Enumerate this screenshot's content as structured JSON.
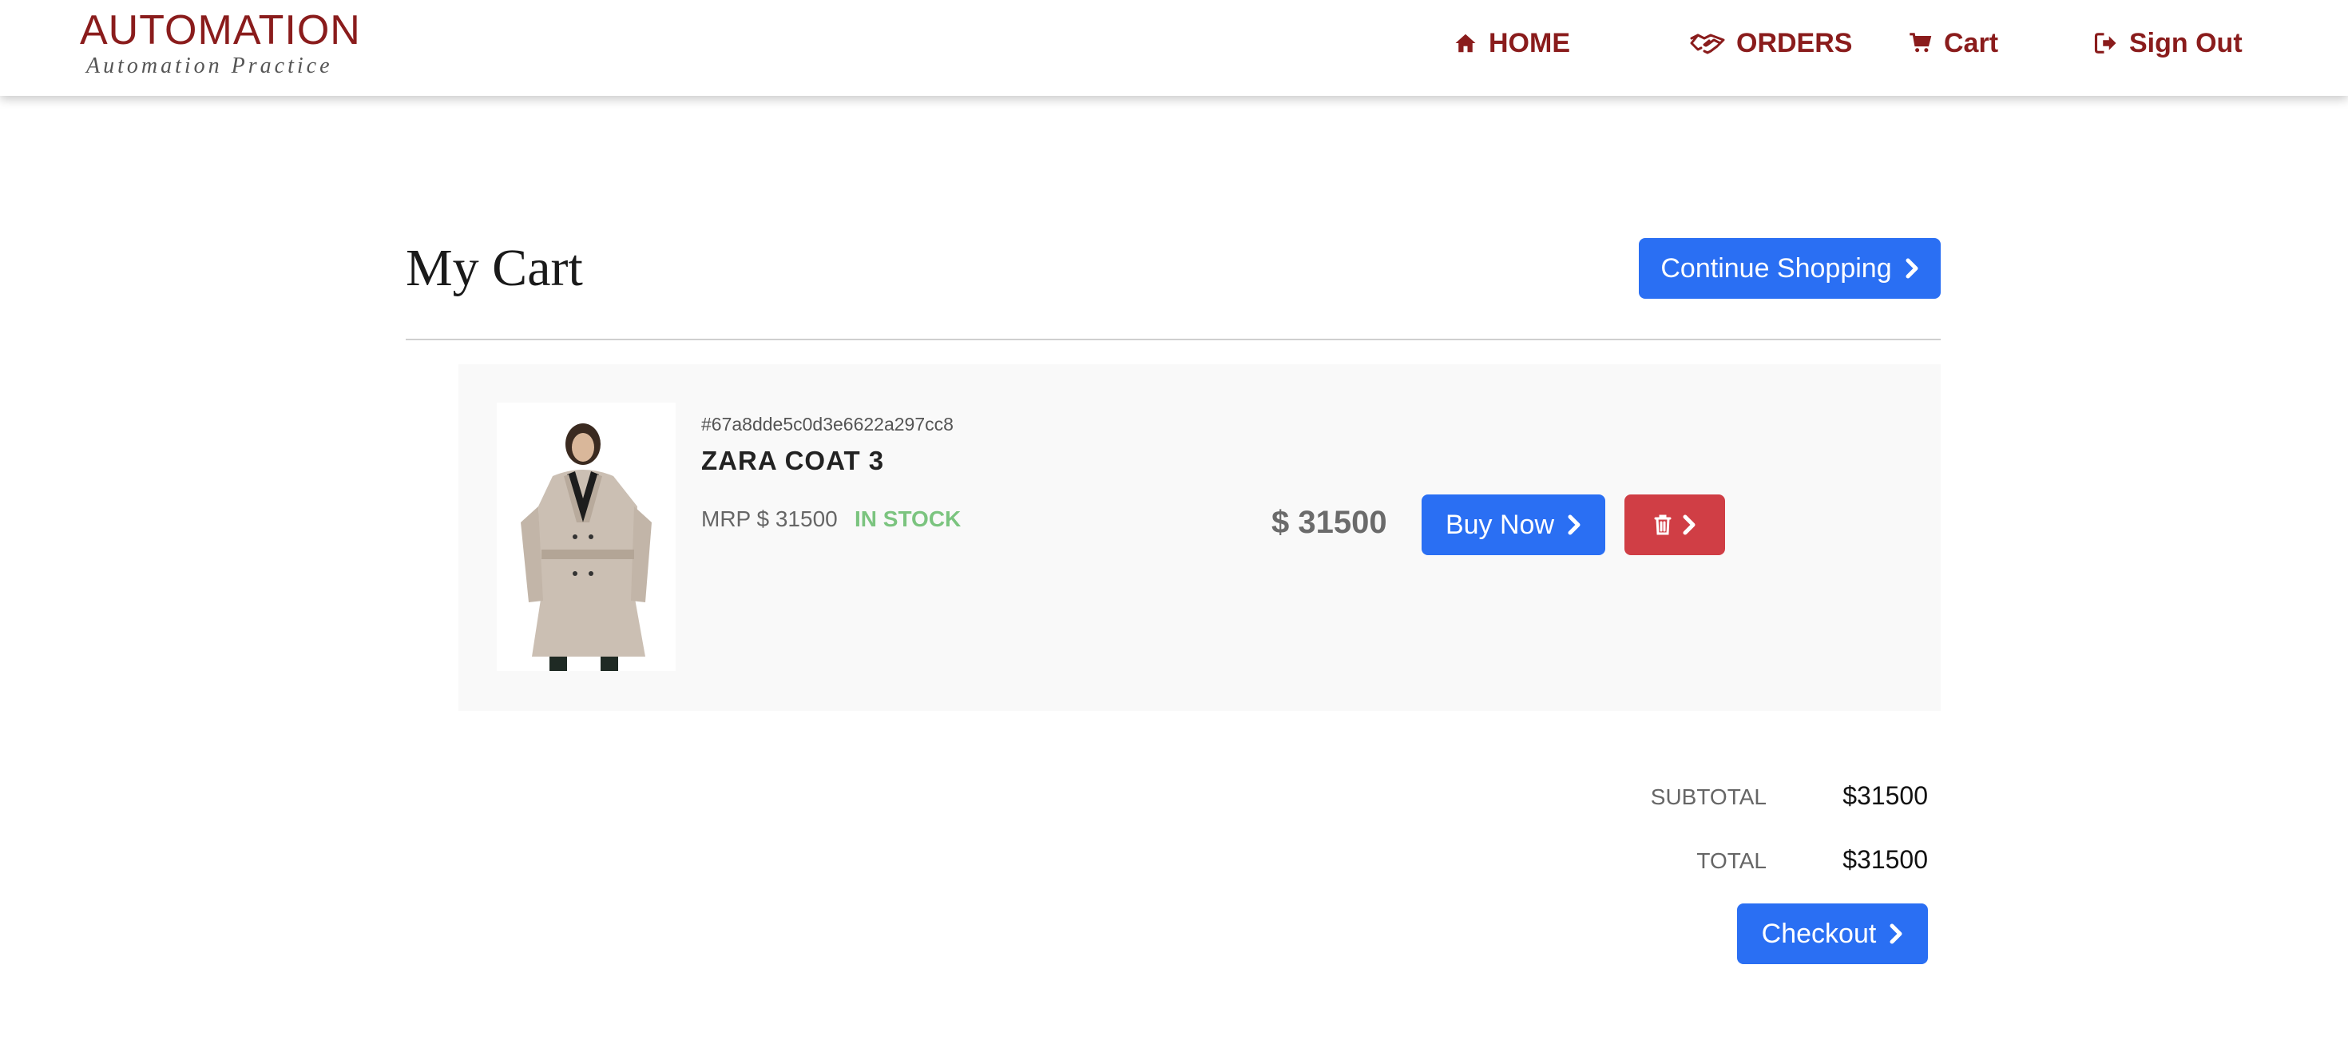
{
  "header": {
    "logo_main": "AUTOMATION",
    "logo_sub": "Automation Practice",
    "nav": {
      "home": "HOME",
      "orders": "ORDERS",
      "cart": "Cart",
      "sign_out": "Sign Out"
    },
    "icons": {
      "home": "home-icon",
      "orders": "handshake-icon",
      "cart": "cart-icon",
      "sign_out": "sign-out-icon"
    }
  },
  "main": {
    "title": "My Cart",
    "continue_shopping_label": "Continue Shopping"
  },
  "cart_items": [
    {
      "id": "#67a8dde5c0d3e6622a297cc8",
      "name": "ZARA COAT 3",
      "mrp": "MRP $ 31500",
      "stock": "IN STOCK",
      "price": "$ 31500",
      "buy_label": "Buy Now",
      "image": "coat-product-image"
    }
  ],
  "summary": {
    "subtotal_label": "SUBTOTAL",
    "subtotal_value": "$31500",
    "total_label": "TOTAL",
    "total_value": "$31500",
    "checkout_label": "Checkout"
  },
  "colors": {
    "brand": "#8a1c1c",
    "primary_button": "#2a6ff3",
    "danger_button": "#d03e45",
    "in_stock": "#7bc47f"
  }
}
